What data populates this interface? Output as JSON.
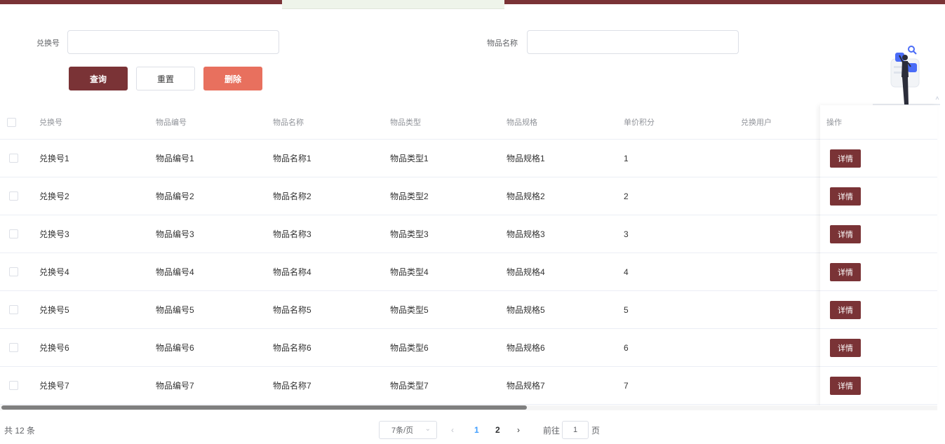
{
  "search": {
    "exchange_no_label": "兑换号",
    "exchange_no_value": "",
    "item_name_label": "物品名称",
    "item_name_value": ""
  },
  "buttons": {
    "query": "查询",
    "reset": "重置",
    "delete": "删除"
  },
  "table": {
    "columns": [
      "兑换号",
      "物品编号",
      "物品名称",
      "物品类型",
      "物品规格",
      "单价积分",
      "兑换用户",
      "操作"
    ],
    "detail_label": "详情",
    "rows": [
      [
        "兑换号1",
        "物品编号1",
        "物品名称1",
        "物品类型1",
        "物品规格1",
        "1",
        ""
      ],
      [
        "兑换号2",
        "物品编号2",
        "物品名称2",
        "物品类型2",
        "物品规格2",
        "2",
        ""
      ],
      [
        "兑换号3",
        "物品编号3",
        "物品名称3",
        "物品类型3",
        "物品规格3",
        "3",
        ""
      ],
      [
        "兑换号4",
        "物品编号4",
        "物品名称4",
        "物品类型4",
        "物品规格4",
        "4",
        ""
      ],
      [
        "兑换号5",
        "物品编号5",
        "物品名称5",
        "物品类型5",
        "物品规格5",
        "5",
        ""
      ],
      [
        "兑换号6",
        "物品编号6",
        "物品名称6",
        "物品类型6",
        "物品规格6",
        "6",
        ""
      ],
      [
        "兑换号7",
        "物品编号7",
        "物品名称7",
        "物品类型7",
        "物品规格7",
        "7",
        ""
      ]
    ]
  },
  "pagination": {
    "total": "共 12 条",
    "page_size": "7条/页",
    "pages": [
      "1",
      "2"
    ],
    "current_page": "1",
    "goto_prefix": "前往",
    "goto_value": "1",
    "goto_suffix": "页"
  },
  "colors": {
    "primary": "#7a3336",
    "danger": "#e8705e",
    "active_page": "#409eff"
  },
  "icons": {
    "select_caret": "chevron-down-icon",
    "prev": "chevron-left-icon",
    "next": "chevron-right-icon",
    "illustration": "person-search-illustration"
  }
}
